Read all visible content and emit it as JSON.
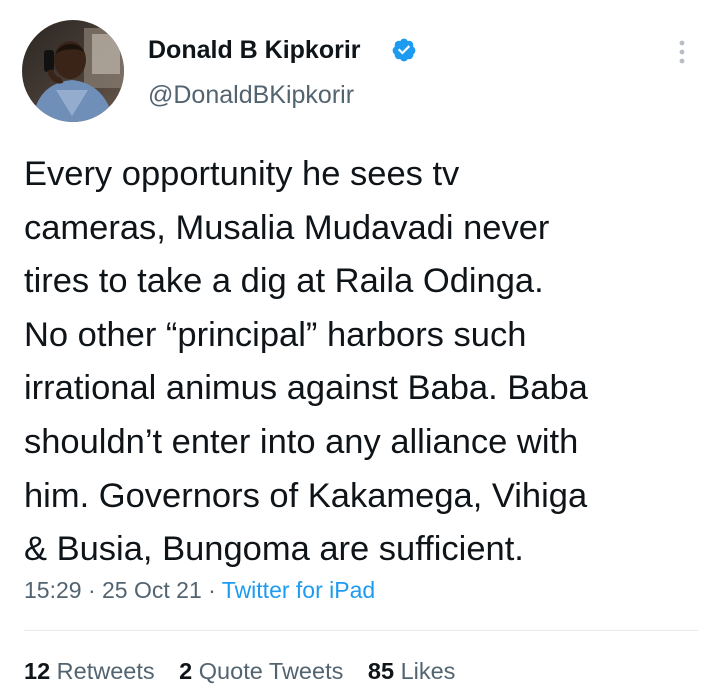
{
  "author": {
    "display_name": "Donald B Kipkorir",
    "handle": "@DonaldBKipkorir",
    "verified_color": "#1d9bf0"
  },
  "tweet": {
    "text": "Every opportunity he sees tv\ncameras, Musalia Mudavadi never\ntires to take a dig at Raila Odinga.\nNo other “principal” harbors such\nirrational animus against Baba. Baba\nshouldn’t enter into any alliance with\nhim. Governors of Kakamega, Vihiga\n& Busia, Bungoma are sufficient.",
    "time": "15:29",
    "separator": "·",
    "date": "25 Oct 21",
    "source": "Twitter for iPad"
  },
  "stats": {
    "retweets_count": "12",
    "retweets_label": "Retweets",
    "quotes_count": "2",
    "quotes_label": "Quote Tweets",
    "likes_count": "85",
    "likes_label": "Likes"
  },
  "icons": {
    "verified": "verified-badge-icon",
    "more": "more-vertical-icon"
  },
  "colors": {
    "accent": "#1d9bf0",
    "secondary_text": "#536471",
    "primary_text": "#0f1419"
  }
}
